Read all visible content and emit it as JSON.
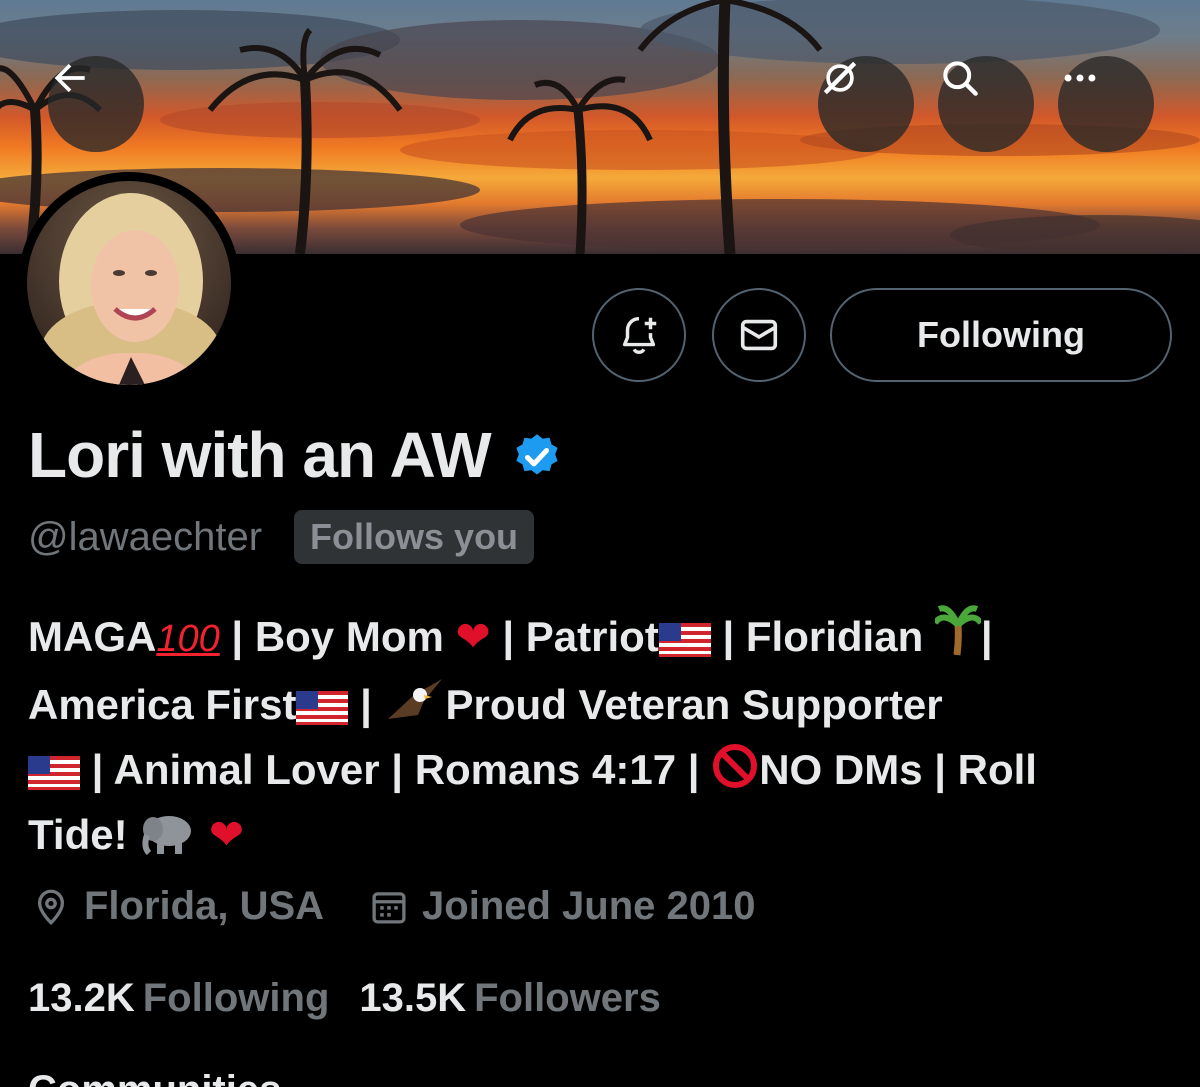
{
  "header": {
    "back_icon": "arrow-left-icon",
    "grok_icon": "grok-slash-icon",
    "search_icon": "search-icon",
    "more_icon": "more-horizontal-icon"
  },
  "profile": {
    "display_name": "Lori with an AW",
    "verified_icon": "verified-badge-icon",
    "verified_color": "#1d9bf0",
    "handle": "@lawaechter",
    "follows_you_badge": "Follows you",
    "bio": {
      "line1_maga": "MAGA",
      "line1_sep1": " | Boy Mom ",
      "line1_sep2": " | Patriot",
      "line1_sep3": " | Floridian ",
      "line1_end": "|",
      "line2_a": "America First",
      "line2_b": " | ",
      "line2_c": "Proud Veteran Supporter",
      "line3_a": " | Animal Lover | Romans 4:17 | ",
      "line3_b": "NO DMs | Roll",
      "line4_a": "Tide! "
    },
    "location": "Florida, USA",
    "location_icon": "location-pin-icon",
    "joined": "Joined June 2010",
    "joined_icon": "calendar-icon",
    "following_count": "13.2K",
    "following_label": "Following",
    "followers_count": "13.5K",
    "followers_label": "Followers"
  },
  "actions": {
    "notify_icon": "bell-plus-icon",
    "message_icon": "envelope-icon",
    "following_button": "Following"
  },
  "below_fold": {
    "section_title": "Communities"
  },
  "colors": {
    "background": "#000000",
    "primary_text": "#e7e9ea",
    "secondary_text": "#71767b",
    "border": "#536471",
    "badge_bg": "#2f3336"
  }
}
